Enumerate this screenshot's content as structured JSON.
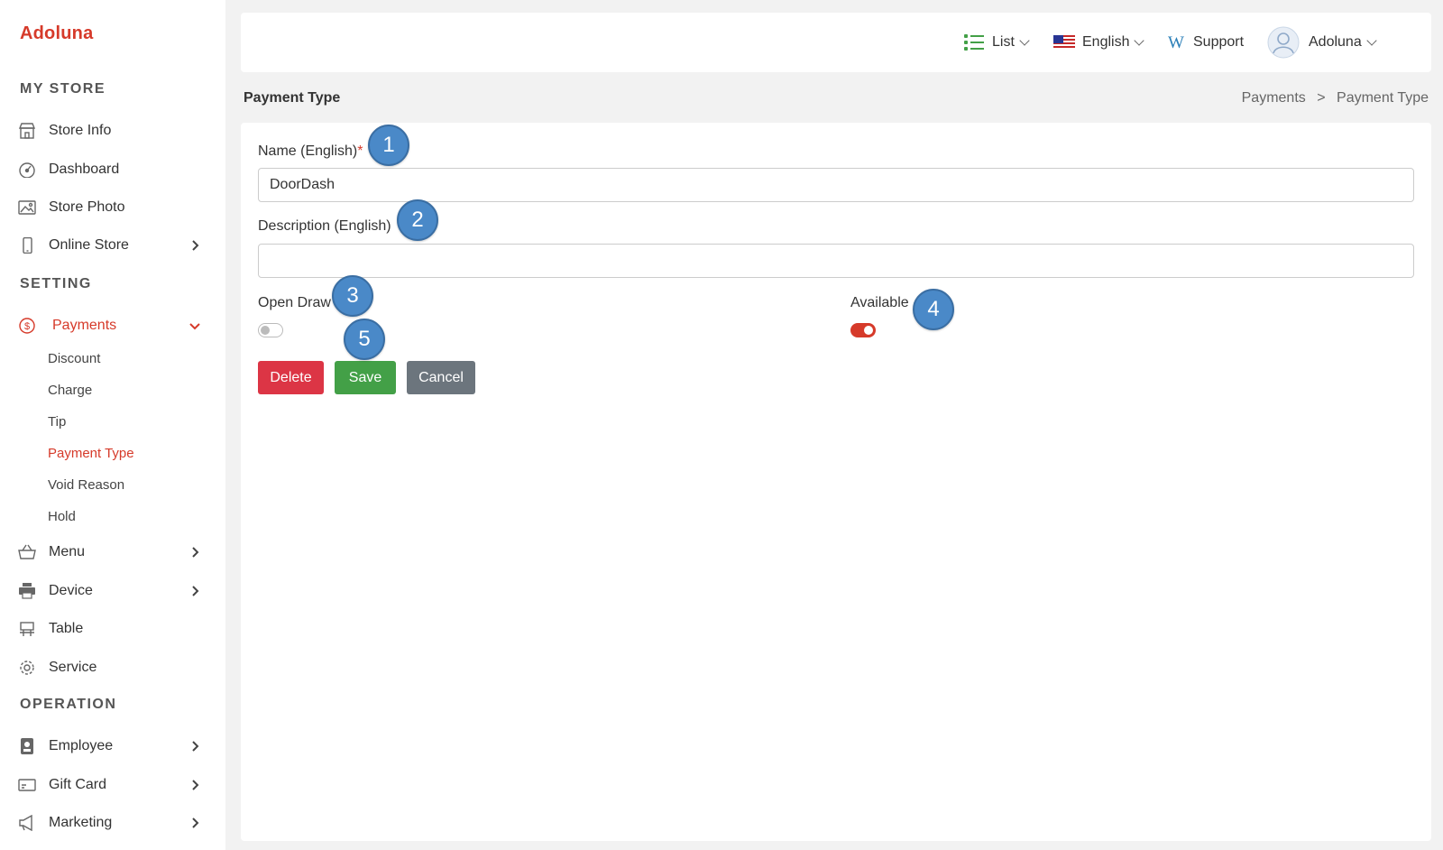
{
  "app": {
    "brand": "Adoluna"
  },
  "sidebar": {
    "sections": [
      "MY STORE",
      "SETTING",
      "OPERATION"
    ],
    "items": [
      {
        "label": "Store Info",
        "icon": "store-icon"
      },
      {
        "label": "Dashboard",
        "icon": "gauge-icon"
      },
      {
        "label": "Store Photo",
        "icon": "photo-icon"
      },
      {
        "label": "Online Store",
        "icon": "mobile-icon",
        "has_arrow": true
      },
      {
        "label": "Payments",
        "icon": "dollar-icon",
        "expanded": true,
        "active": true
      },
      {
        "label": "Menu",
        "icon": "basket-icon",
        "has_arrow": true
      },
      {
        "label": "Device",
        "icon": "printer-icon",
        "has_arrow": true
      },
      {
        "label": "Table",
        "icon": "table-icon"
      },
      {
        "label": "Service",
        "icon": "gear-icon"
      },
      {
        "label": "Employee",
        "icon": "badge-icon",
        "has_arrow": true
      },
      {
        "label": "Gift Card",
        "icon": "gift-card-icon",
        "has_arrow": true
      },
      {
        "label": "Marketing",
        "icon": "megaphone-icon",
        "has_arrow": true
      }
    ],
    "payments_sub": [
      "Discount",
      "Charge",
      "Tip",
      "Payment Type",
      "Void Reason",
      "Hold"
    ],
    "active_sub": "Payment Type"
  },
  "header": {
    "view_label": "List",
    "language_label": "English",
    "support_label": "Support",
    "user_label": "Adoluna"
  },
  "page": {
    "title": "Payment Type",
    "breadcrumb": [
      "Payments",
      ">",
      "Payment Type"
    ]
  },
  "form": {
    "name_label": "Name (English)",
    "required_mark": "*",
    "name_value": "DoorDash",
    "description_label": "Description (English)",
    "description_value": "",
    "open_draw_label": "Open Draw",
    "open_draw_on": false,
    "available_label": "Available",
    "available_on": true,
    "delete_label": "Delete",
    "save_label": "Save",
    "cancel_label": "Cancel"
  },
  "markers": [
    "1",
    "2",
    "3",
    "4",
    "5"
  ],
  "colors": {
    "accent": "#d63a2a",
    "delete": "#dc3545",
    "save": "#43a047",
    "cancel": "#6c757d",
    "marker": "#4a89c8"
  }
}
